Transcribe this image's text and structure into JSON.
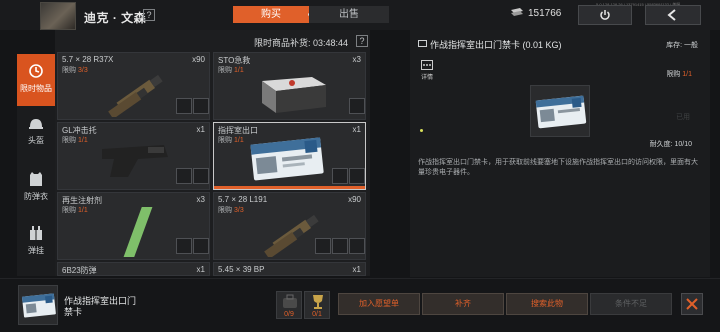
{
  "header": {
    "player_name": "迪克 · 文森",
    "help_mark": "?",
    "tabs": [
      {
        "label": "购买",
        "active": true
      },
      {
        "label": "出售",
        "active": false
      }
    ],
    "currency_amount": "151766",
    "build_info": "5.0.128.128.26 | 13791415 | 5583691132 | 美服",
    "accent_color": "#e0602a"
  },
  "categories": [
    {
      "label": "限时物品",
      "icon": "clock-icon",
      "active": true
    },
    {
      "label": "头盔",
      "icon": "helmet-icon",
      "active": false
    },
    {
      "label": "防弹衣",
      "icon": "vest-icon",
      "active": false
    },
    {
      "label": "弹挂",
      "icon": "chest-rig-icon",
      "active": false
    }
  ],
  "shop": {
    "timer_label": "限时商品补货: 03:48:44",
    "timer_help": "?",
    "limit_prefix": "限购",
    "items": [
      {
        "name": "5.7 × 28 R37X",
        "limit": "3/3",
        "qty": "x90",
        "icon": "ammo-icon"
      },
      {
        "name": "STO急救",
        "limit": "1/1",
        "qty": "x3",
        "icon": "medkit-icon"
      },
      {
        "name": "GL冲击托",
        "limit": "1/1",
        "qty": "x1",
        "icon": "stock-icon"
      },
      {
        "name": "指挥室出口",
        "limit": "1/1",
        "qty": "x1",
        "icon": "keycard-icon",
        "selected": true
      },
      {
        "name": "再生注射剂",
        "limit": "1/1",
        "qty": "x3",
        "icon": "injector-icon"
      },
      {
        "name": "5.7 × 28 L191",
        "limit": "3/3",
        "qty": "x90",
        "icon": "ammo-icon"
      },
      {
        "name": "6B23防弹",
        "limit": "",
        "qty": "x1",
        "icon": "armor-icon"
      },
      {
        "name": "5.45 × 39 BP",
        "limit": "",
        "qty": "x1",
        "icon": "ammo-icon"
      }
    ]
  },
  "detail": {
    "title": "作战指挥室出口门禁卡 (0.01 KG)",
    "stock_label": "库存: 一般",
    "details_label": "详情",
    "limit_label": "限购",
    "limit_value": "1/1",
    "unused_label": "已用",
    "durability_label": "耐久度: 10/10",
    "description": "作战指挥室出口门禁卡，用于获取前线要塞地下设施作战指挥室出口的访问权限，里面有大量珍贵电子器件。"
  },
  "bottom": {
    "selected_name": "作战指挥室出口门禁卡",
    "materials": [
      {
        "count": "0/9",
        "icon": "bag-icon"
      },
      {
        "count": "0/1",
        "icon": "trophy-icon"
      }
    ],
    "buttons": [
      {
        "label": "加入愿望单",
        "disabled": false
      },
      {
        "label": "补齐",
        "disabled": false
      },
      {
        "label": "搜索此物",
        "disabled": false
      },
      {
        "label": "条件不足",
        "disabled": true
      }
    ]
  }
}
